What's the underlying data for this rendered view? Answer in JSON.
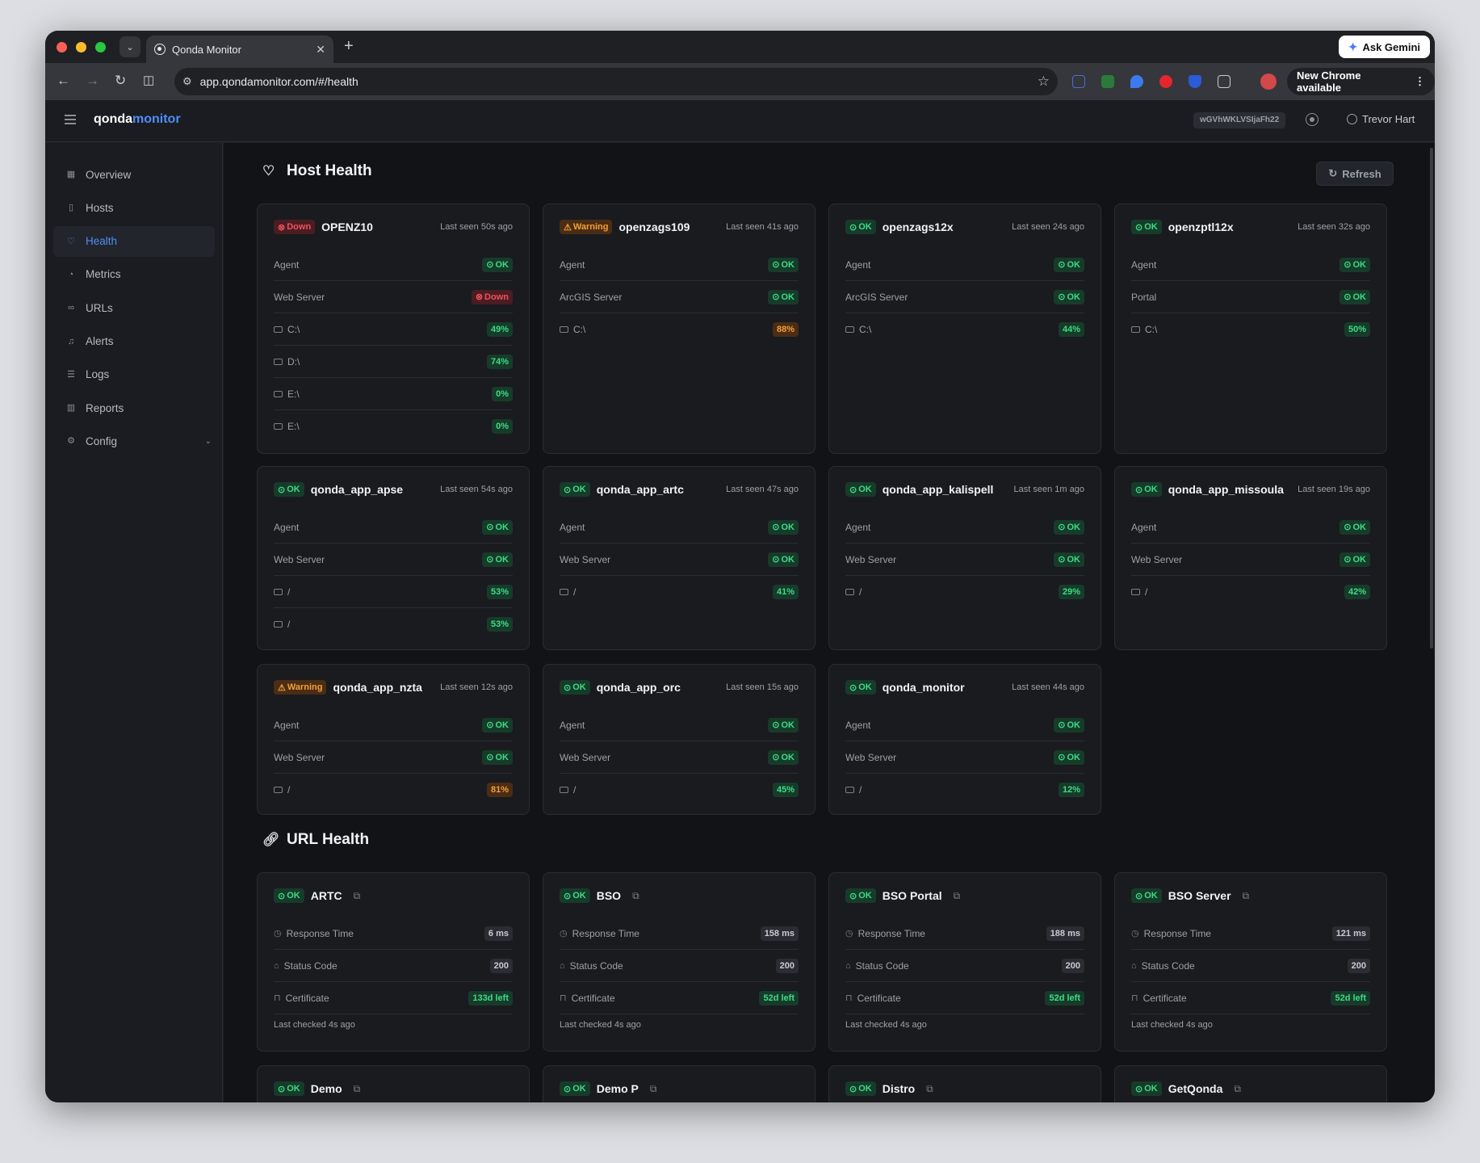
{
  "browser": {
    "tab_title": "Qonda Monitor",
    "url": "app.qondamonitor.com/#/health",
    "ask_gemini": "Ask Gemini",
    "new_chrome": "New Chrome available"
  },
  "app": {
    "logo_a": "qonda",
    "logo_b": "monitor",
    "token": "wGVhWKLVSIjaFh22",
    "user": "Trevor Hart"
  },
  "nav": [
    {
      "label": "Overview",
      "icon": "grid-icon"
    },
    {
      "label": "Hosts",
      "icon": "server-icon"
    },
    {
      "label": "Health",
      "icon": "heart-icon",
      "active": true
    },
    {
      "label": "Metrics",
      "icon": "gauge-icon"
    },
    {
      "label": "URLs",
      "icon": "link-icon"
    },
    {
      "label": "Alerts",
      "icon": "bell-icon"
    },
    {
      "label": "Logs",
      "icon": "list-icon"
    },
    {
      "label": "Reports",
      "icon": "bar-chart-icon"
    },
    {
      "label": "Config",
      "icon": "gear-icon",
      "chevron": true
    }
  ],
  "host_health": {
    "title": "Host Health",
    "refresh": "Refresh",
    "hosts": [
      {
        "status": "Down",
        "name": "OPENZ10",
        "seen": "Last seen 50s ago",
        "rows": [
          {
            "label": "Agent",
            "value": "OK",
            "kind": "ok"
          },
          {
            "label": "Web Server",
            "value": "Down",
            "kind": "down"
          },
          {
            "label": "C:\\",
            "value": "49%",
            "kind": "ok",
            "disk": true
          },
          {
            "label": "D:\\",
            "value": "74%",
            "kind": "ok",
            "disk": true
          },
          {
            "label": "E:\\",
            "value": "0%",
            "kind": "ok",
            "disk": true
          },
          {
            "label": "E:\\",
            "value": "0%",
            "kind": "ok",
            "disk": true
          }
        ]
      },
      {
        "status": "Warning",
        "name": "openzags109",
        "seen": "Last seen 41s ago",
        "rows": [
          {
            "label": "Agent",
            "value": "OK",
            "kind": "ok"
          },
          {
            "label": "ArcGIS Server",
            "value": "OK",
            "kind": "ok"
          },
          {
            "label": "C:\\",
            "value": "88%",
            "kind": "warn",
            "disk": true
          }
        ]
      },
      {
        "status": "OK",
        "name": "openzags12x",
        "seen": "Last seen 24s ago",
        "rows": [
          {
            "label": "Agent",
            "value": "OK",
            "kind": "ok"
          },
          {
            "label": "ArcGIS Server",
            "value": "OK",
            "kind": "ok"
          },
          {
            "label": "C:\\",
            "value": "44%",
            "kind": "ok",
            "disk": true
          }
        ]
      },
      {
        "status": "OK",
        "name": "openzptl12x",
        "seen": "Last seen 32s ago",
        "rows": [
          {
            "label": "Agent",
            "value": "OK",
            "kind": "ok"
          },
          {
            "label": "Portal",
            "value": "OK",
            "kind": "ok"
          },
          {
            "label": "C:\\",
            "value": "50%",
            "kind": "ok",
            "disk": true
          }
        ]
      },
      {
        "status": "OK",
        "name": "qonda_app_apse",
        "seen": "Last seen 54s ago",
        "rows": [
          {
            "label": "Agent",
            "value": "OK",
            "kind": "ok"
          },
          {
            "label": "Web Server",
            "value": "OK",
            "kind": "ok"
          },
          {
            "label": "/",
            "value": "53%",
            "kind": "ok",
            "disk": true
          },
          {
            "label": "/",
            "value": "53%",
            "kind": "ok",
            "disk": true
          }
        ]
      },
      {
        "status": "OK",
        "name": "qonda_app_artc",
        "seen": "Last seen 47s ago",
        "rows": [
          {
            "label": "Agent",
            "value": "OK",
            "kind": "ok"
          },
          {
            "label": "Web Server",
            "value": "OK",
            "kind": "ok"
          },
          {
            "label": "/",
            "value": "41%",
            "kind": "ok",
            "disk": true
          }
        ]
      },
      {
        "status": "OK",
        "name": "qonda_app_kalispell",
        "seen": "Last seen 1m ago",
        "rows": [
          {
            "label": "Agent",
            "value": "OK",
            "kind": "ok"
          },
          {
            "label": "Web Server",
            "value": "OK",
            "kind": "ok"
          },
          {
            "label": "/",
            "value": "29%",
            "kind": "ok",
            "disk": true
          }
        ]
      },
      {
        "status": "OK",
        "name": "qonda_app_missoula",
        "seen": "Last seen 19s ago",
        "rows": [
          {
            "label": "Agent",
            "value": "OK",
            "kind": "ok"
          },
          {
            "label": "Web Server",
            "value": "OK",
            "kind": "ok"
          },
          {
            "label": "/",
            "value": "42%",
            "kind": "ok",
            "disk": true
          }
        ]
      },
      {
        "status": "Warning",
        "name": "qonda_app_nzta",
        "seen": "Last seen 12s ago",
        "rows": [
          {
            "label": "Agent",
            "value": "OK",
            "kind": "ok"
          },
          {
            "label": "Web Server",
            "value": "OK",
            "kind": "ok"
          },
          {
            "label": "/",
            "value": "81%",
            "kind": "warn",
            "disk": true
          }
        ]
      },
      {
        "status": "OK",
        "name": "qonda_app_orc",
        "seen": "Last seen 15s ago",
        "rows": [
          {
            "label": "Agent",
            "value": "OK",
            "kind": "ok"
          },
          {
            "label": "Web Server",
            "value": "OK",
            "kind": "ok"
          },
          {
            "label": "/",
            "value": "45%",
            "kind": "ok",
            "disk": true
          }
        ]
      },
      {
        "status": "OK",
        "name": "qonda_monitor",
        "seen": "Last seen 44s ago",
        "rows": [
          {
            "label": "Agent",
            "value": "OK",
            "kind": "ok"
          },
          {
            "label": "Web Server",
            "value": "OK",
            "kind": "ok"
          },
          {
            "label": "/",
            "value": "12%",
            "kind": "ok",
            "disk": true
          }
        ]
      }
    ]
  },
  "url_health": {
    "title": "URL Health",
    "labels": {
      "response": "Response Time",
      "status": "Status Code",
      "cert": "Certificate"
    },
    "urls": [
      {
        "status": "OK",
        "name": "ARTC",
        "response": "6 ms",
        "code": "200",
        "cert": "133d left",
        "checked": "Last checked 4s ago"
      },
      {
        "status": "OK",
        "name": "BSO",
        "response": "158 ms",
        "code": "200",
        "cert": "52d left",
        "checked": "Last checked 4s ago"
      },
      {
        "status": "OK",
        "name": "BSO Portal",
        "response": "188 ms",
        "code": "200",
        "cert": "52d left",
        "checked": "Last checked 4s ago"
      },
      {
        "status": "OK",
        "name": "BSO Server",
        "response": "121 ms",
        "code": "200",
        "cert": "52d left",
        "checked": "Last checked 4s ago"
      },
      {
        "status": "OK",
        "name": "Demo"
      },
      {
        "status": "OK",
        "name": "Demo P"
      },
      {
        "status": "OK",
        "name": "Distro"
      },
      {
        "status": "OK",
        "name": "GetQonda"
      }
    ]
  }
}
